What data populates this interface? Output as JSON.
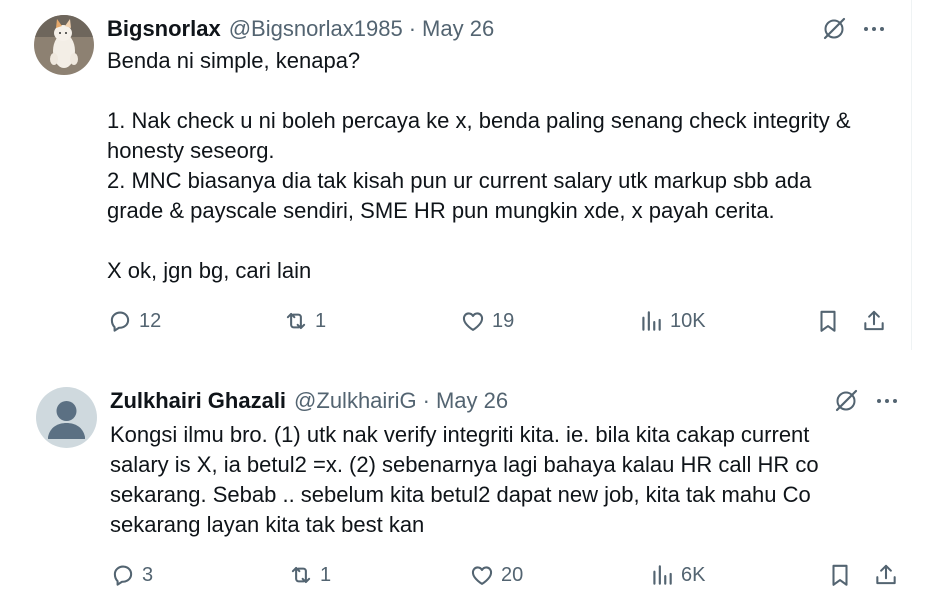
{
  "tweets": [
    {
      "author": "Bigsnorlax",
      "handle": "@Bigsnorlax1985",
      "separator": "·",
      "date": "May 26",
      "lines": [
        "Benda ni simple, kenapa?",
        "",
        "1. Nak check u ni boleh percaya ke x, benda paling senang check integrity &",
        "honesty seseorg.",
        "2. MNC biasanya dia tak kisah pun ur current salary utk markup sbb ada",
        "grade & payscale sendiri, SME HR pun mungkin xde, x payah cerita.",
        "",
        "X ok, jgn bg, cari lain"
      ],
      "replies": "12",
      "retweets": "1",
      "likes": "19",
      "views": "10K"
    },
    {
      "author": "Zulkhairi Ghazali",
      "handle": "@ZulkhairiG",
      "separator": "·",
      "date": "May 26",
      "lines": [
        "Kongsi ilmu bro. (1) utk nak verify integriti kita. ie. bila kita cakap current",
        "salary is X, ia betul2 =x. (2) sebenarnya lagi bahaya kalau HR call HR co",
        "sekarang. Sebab .. sebelum kita betul2 dapat new job, kita tak mahu Co",
        "sekarang layan kita tak best kan"
      ],
      "replies": "3",
      "retweets": "1",
      "likes": "20",
      "views": "6K"
    }
  ],
  "colors": {
    "text": "#0f1419",
    "secondary": "#536471",
    "avatar_default_bg": "#cfd9de"
  },
  "icons": [
    "grok-icon",
    "more-icon",
    "reply-icon",
    "retweet-icon",
    "like-icon",
    "views-icon",
    "bookmark-icon",
    "share-icon"
  ]
}
